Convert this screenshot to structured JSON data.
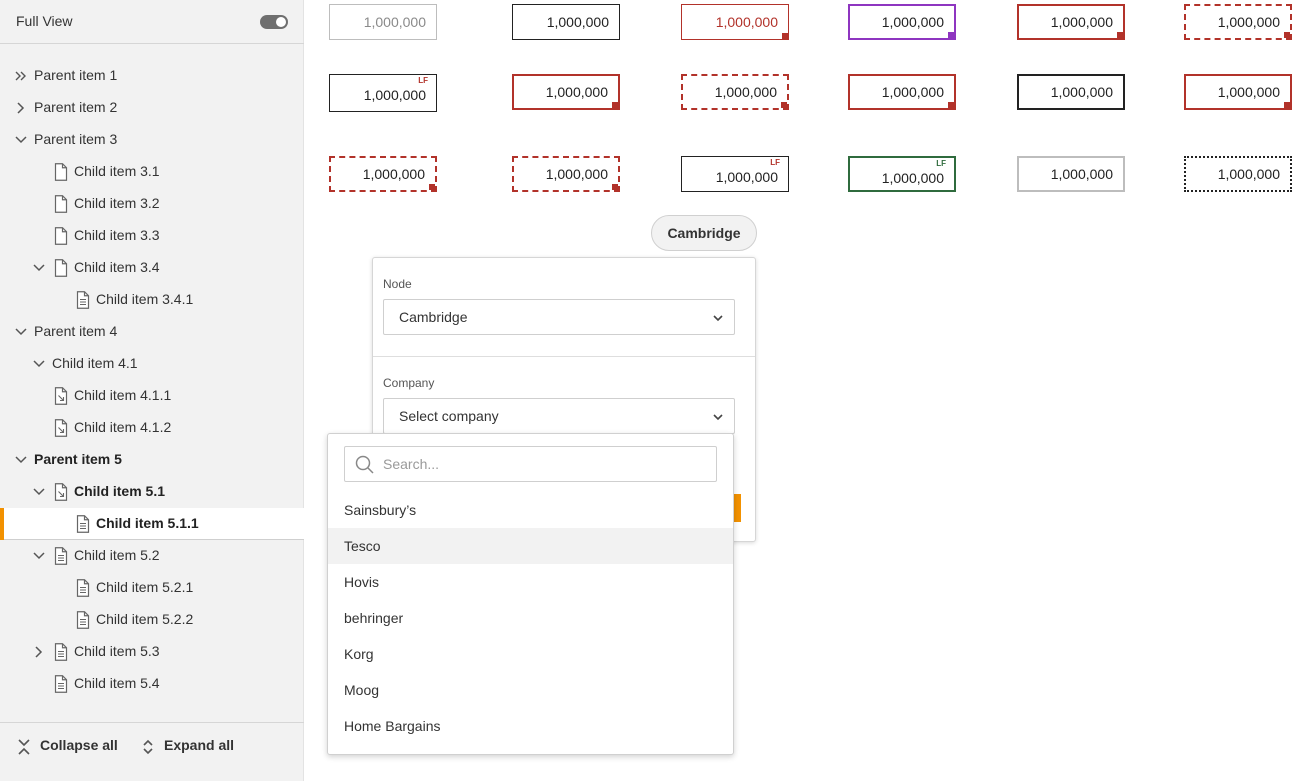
{
  "sidebar": {
    "title": "Full View",
    "items": [
      {
        "label": "Parent item 1",
        "expand": "double"
      },
      {
        "label": "Parent item 2",
        "expand": "collapsed"
      },
      {
        "label": "Parent item 3",
        "expand": "expanded"
      },
      {
        "label": "Child item 3.1",
        "icon": "file"
      },
      {
        "label": "Child item 3.2",
        "icon": "file"
      },
      {
        "label": "Child item 3.3",
        "icon": "file"
      },
      {
        "label": "Child item 3.4",
        "icon": "file",
        "expand": "expanded"
      },
      {
        "label": "Child item 3.4.1",
        "icon": "file-lines"
      },
      {
        "label": "Parent item 4",
        "expand": "expanded"
      },
      {
        "label": "Child item 4.1",
        "expand": "expanded"
      },
      {
        "label": "Child item 4.1.1",
        "icon": "file-link"
      },
      {
        "label": "Child item 4.1.2",
        "icon": "file-link"
      },
      {
        "label": "Parent item 5",
        "expand": "expanded",
        "bold": true
      },
      {
        "label": "Child item 5.1",
        "icon": "file-link",
        "expand": "expanded",
        "bold": true
      },
      {
        "label": "Child item 5.1.1",
        "icon": "file-lines",
        "bold": true,
        "selected": true
      },
      {
        "label": "Child item 5.2",
        "icon": "file-lines",
        "expand": "expanded"
      },
      {
        "label": "Child item 5.2.1",
        "icon": "file-lines"
      },
      {
        "label": "Child item 5.2.2",
        "icon": "file-lines"
      },
      {
        "label": "Child item 5.3",
        "icon": "file-lines",
        "expand": "collapsed"
      },
      {
        "label": "Child item 5.4",
        "icon": "file-lines"
      }
    ],
    "collapse_all": "Collapse all",
    "expand_all": "Expand all"
  },
  "cells": {
    "value": "1,000,000",
    "lf_tag": "LF"
  },
  "node_pill": "Cambridge",
  "panel": {
    "node_label": "Node",
    "node_value": "Cambridge",
    "company_label": "Company",
    "company_placeholder": "Select company"
  },
  "dropdown": {
    "search_placeholder": "Search...",
    "options": [
      "Sainsbury’s",
      "Tesco",
      "Hovis",
      "behringer",
      "Korg",
      "Moog",
      "Home Bargains"
    ],
    "hovered_option": "Tesco"
  },
  "colors": {
    "accent": "#f29100",
    "error": "#b2322a",
    "warning_purple": "#8e35c0",
    "success": "#2f6b3d"
  }
}
